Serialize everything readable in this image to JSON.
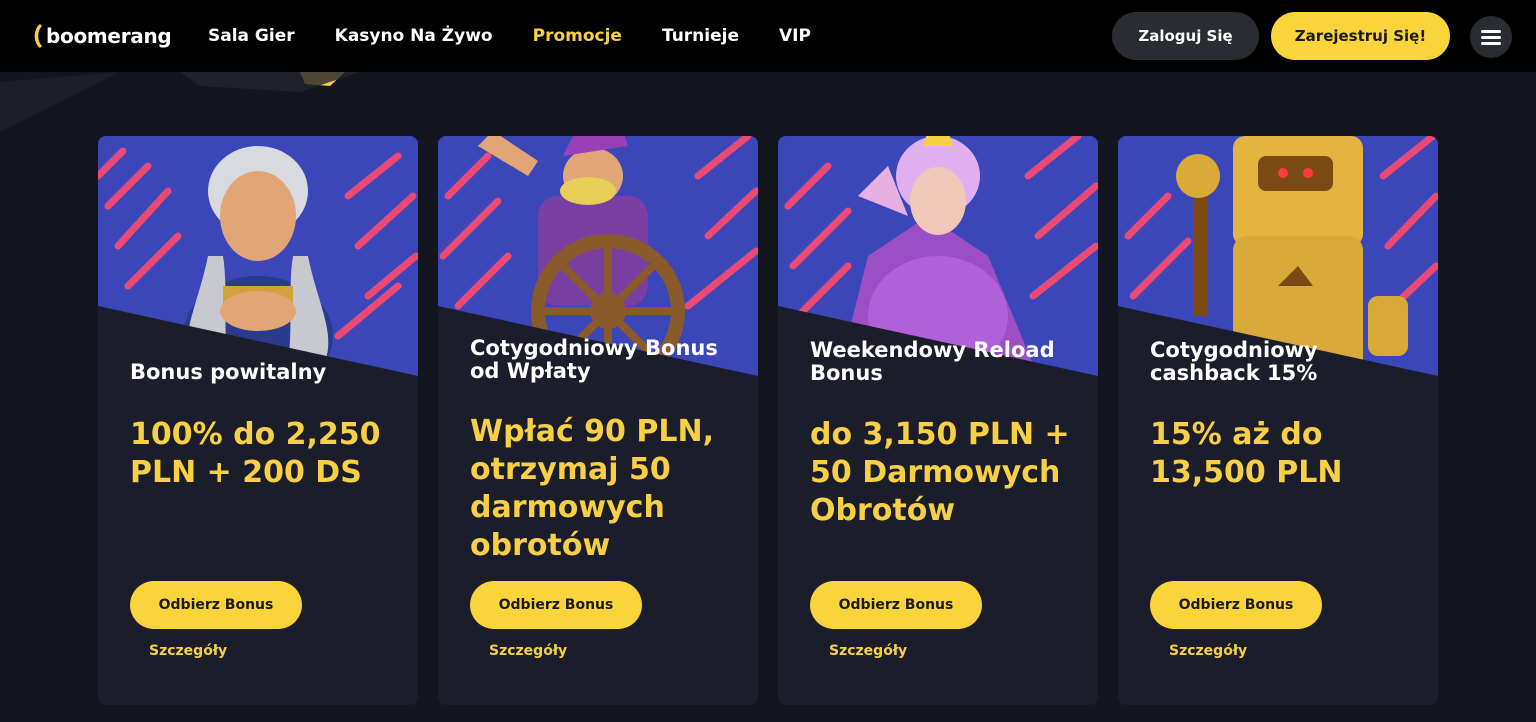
{
  "brand": {
    "logo_text": "boomerang",
    "accent": "#f7d046",
    "button_yellow": "#f9d43a"
  },
  "nav": {
    "items": [
      {
        "label": "Sala Gier"
      },
      {
        "label": "Kasyno Na Żywo"
      },
      {
        "label": "Promocje",
        "active": true
      },
      {
        "label": "Turnieje"
      },
      {
        "label": "VIP"
      }
    ]
  },
  "header": {
    "login_label": "Zaloguj Się",
    "register_label": "Zarejestruj Się!",
    "menu_icon": "hamburger-icon"
  },
  "cards": [
    {
      "title": "Bonus powitalny",
      "offer": "100% do 2,250 PLN + 200 DS",
      "button": "Odbierz Bonus",
      "link": "Szczegóły",
      "art": "warrior-woman-character"
    },
    {
      "title": "Cotygodniowy Bonus od Wpłaty",
      "offer": "Wpłać 90 PLN, otrzymaj 50 darmowych obrotów",
      "button": "Odbierz Bonus",
      "link": "Szczegóły",
      "art": "sea-captain-character"
    },
    {
      "title": "Weekendowy Reload Bonus",
      "offer": "do 3,150 PLN + 50 Darmowych Obrotów",
      "button": "Odbierz Bonus",
      "link": "Szczegóły",
      "art": "queen-character"
    },
    {
      "title": "Cotygodniowy cashback 15%",
      "offer": "15% aż do 13,500 PLN",
      "button": "Odbierz Bonus",
      "link": "Szczegóły",
      "art": "golden-robot-character"
    }
  ]
}
